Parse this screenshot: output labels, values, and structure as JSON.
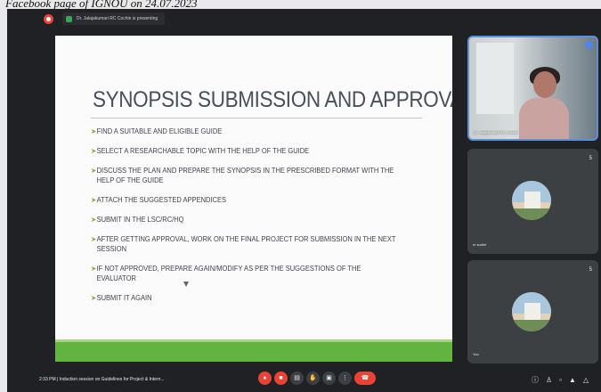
{
  "caption": "Facebook page of IGNOU on 24.07.2023",
  "meeting": {
    "presenting_label": "Dr. Jalajakumari RC Cochin is presenting"
  },
  "slide": {
    "title": "SYNOPSIS SUBMISSION AND APPROVAL",
    "bullets": [
      "FIND A SUITABLE AND ELIGIBLE GUIDE",
      "SELECT A RESEARCHABLE TOPIC WITH THE HELP OF THE GUIDE",
      "DISCUSS THE PLAN AND PREPARE THE SYNOPSIS IN THE PRESCRIBED FORMAT WITH THE HELP OF THE GUIDE",
      "ATTACH THE SUGGESTED APPENDICES",
      "SUBMIT IN THE LSC/RC/HQ",
      "AFTER GETTING APPROVAL, WORK ON THE FINAL PROJECT FOR SUBMISSION IN THE NEXT SESSION",
      "IF NOT APPROVED, PREPARE AGAIN/MODIFY AS PER THE SUGGESTIONS OF THE EVALUATOR",
      "SUBMIT IT AGAIN"
    ],
    "accent_color": "#62b33f"
  },
  "participants": [
    {
      "name": "Dr. Jalajakumari RC Cochin",
      "type": "video"
    },
    {
      "name": "m sudhir",
      "type": "avatar",
      "number": "5"
    },
    {
      "name": "You",
      "type": "avatar",
      "number": "5"
    }
  ],
  "bottom_bar": {
    "meeting_info": "2:33 PM  |  Induction session on Guidelines for Project & Intern..."
  },
  "icons": {
    "recording": "record-icon",
    "mic": "mic-off-icon",
    "camera": "camera-off-icon",
    "captions": "captions-icon",
    "hand": "raise-hand-icon",
    "present": "present-icon",
    "more": "more-options-icon",
    "end": "end-call-icon"
  }
}
